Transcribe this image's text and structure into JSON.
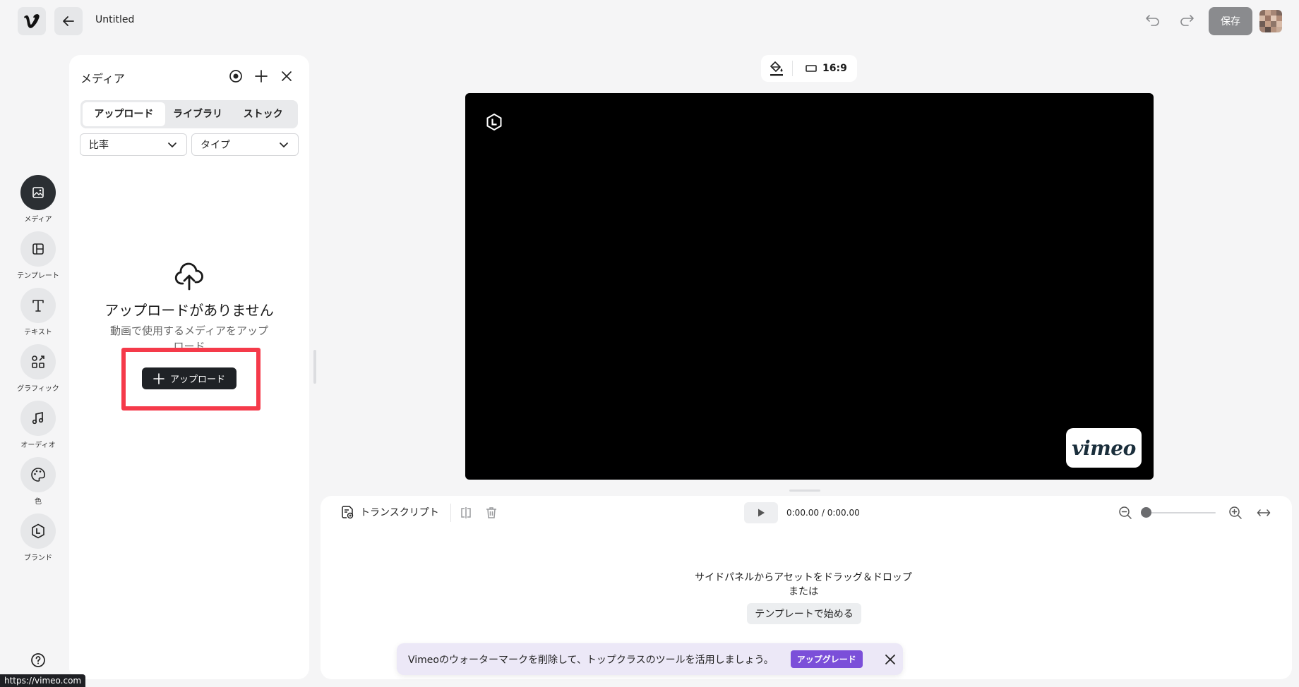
{
  "header": {
    "title": "Untitled",
    "save_label": "保存"
  },
  "rail": {
    "items": [
      {
        "label": "メディア",
        "icon": "image-icon"
      },
      {
        "label": "テンプレート",
        "icon": "layout-icon"
      },
      {
        "label": "テキスト",
        "icon": "text-icon"
      },
      {
        "label": "グラフィック",
        "icon": "shapes-icon"
      },
      {
        "label": "オーディオ",
        "icon": "music-icon"
      },
      {
        "label": "色",
        "icon": "palette-icon"
      },
      {
        "label": "ブランド",
        "icon": "brand-icon"
      }
    ]
  },
  "media_panel": {
    "title": "メディア",
    "tabs": [
      "アップロード",
      "ライブラリ",
      "ストック"
    ],
    "filters": [
      "比率",
      "タイプ"
    ],
    "empty_title": "アップロードがありません",
    "empty_sub": "動画で使用するメディアをアップロード",
    "upload_label": "アップロード"
  },
  "canvas": {
    "aspect_ratio": "16:9",
    "watermark": "vimeo",
    "background_color": "#000000"
  },
  "timeline": {
    "transcript_label": "トランスクリプト",
    "time": "0:00.00 / 0:00.00",
    "drop_line1": "サイドパネルからアセットをドラッグ＆ドロップ",
    "drop_line2": "または",
    "template_button": "テンプレートで始める"
  },
  "banner": {
    "text": "Vimeoのウォーターマークを削除して、トップクラスのツールを活用しましょう。",
    "upgrade_label": "アップグレード"
  },
  "status_bar": {
    "url": "https://vimeo.com"
  },
  "colors": {
    "accent": "#7b4fd9",
    "highlight": "#f53a4a",
    "dark": "#1f2226"
  }
}
